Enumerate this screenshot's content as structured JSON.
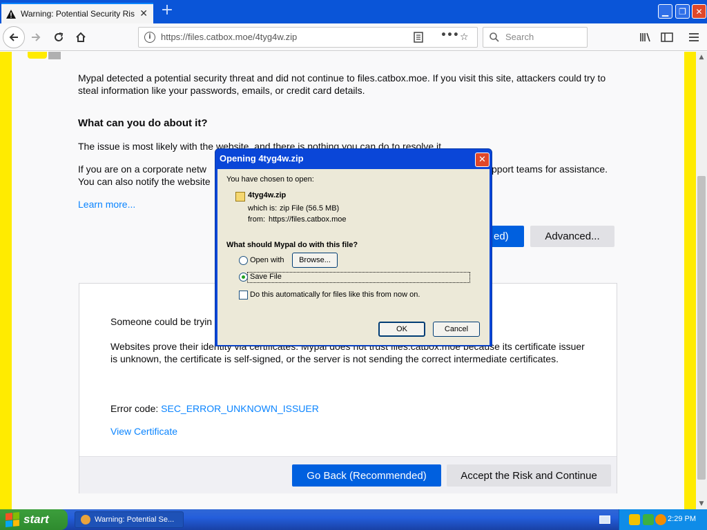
{
  "browser": {
    "tab_title": "Warning: Potential Security Risk A",
    "url": "https://files.catbox.moe/4tyg4w.zip",
    "search_placeholder": "Search"
  },
  "page": {
    "intro": "Mypal detected a potential security threat and did not continue to files.catbox.moe. If you visit this site, attackers could try to steal information like your passwords, emails, or credit card details.",
    "heading": "What can you do about it?",
    "para1": "The issue is most likely with the website, and there is nothing you can do to resolve it.",
    "para2_a": "If you are on a corporate netw",
    "para2_b": "pport teams for assistance.",
    "para2_line2": "You can also notify the website",
    "learn_more": "Learn more...",
    "go_back_partial": "ed)",
    "advanced_button": "Advanced...",
    "adv_someone": "Someone could be tryin",
    "adv_websites": "Websites prove their identity via certificates. Mypal does not trust files.catbox.moe because its certificate issuer is unknown, the certificate is self-signed, or the server is not sending the correct intermediate certificates.",
    "error_code_label": "Error code:",
    "error_code": "SEC_ERROR_UNKNOWN_ISSUER",
    "view_certificate": "View Certificate",
    "go_back_button": "Go Back (Recommended)",
    "accept_button": "Accept the Risk and Continue"
  },
  "dialog": {
    "title": "Opening 4tyg4w.zip",
    "chosen": "You have chosen to open:",
    "filename": "4tyg4w.zip",
    "which_is_label": "which is:",
    "which_is_value": "zip File (56.5 MB)",
    "from_label": "from:",
    "from_value": "https://files.catbox.moe",
    "question": "What should Mypal do with this file?",
    "open_with": "Open with",
    "browse": "Browse...",
    "save_file": "Save File",
    "auto_checkbox": "Do this automatically for files like this from now on.",
    "ok": "OK",
    "cancel": "Cancel",
    "selected_option": "Save File"
  },
  "taskbar": {
    "start": "start",
    "task_item": "Warning: Potential Se...",
    "clock": "2:29 PM"
  }
}
